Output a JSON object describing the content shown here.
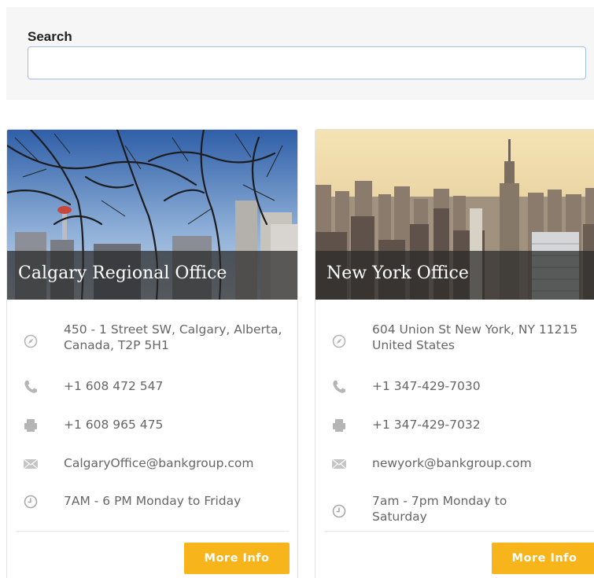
{
  "search": {
    "label": "Search",
    "value": "",
    "placeholder": ""
  },
  "offices": [
    {
      "title": "Calgary Regional Office",
      "address": "450 - 1 Street SW, Calgary, Alberta, Canada, T2P 5H1",
      "phone": "+1 608 472 547",
      "fax": "+1 608 965 475",
      "email": "CalgaryOffice@bankgroup.com",
      "hours": "7AM - 6 PM Monday to Friday",
      "button_label": "More Info"
    },
    {
      "title": "New York Office",
      "address": "604 Union St New York, NY 11215 United States",
      "phone": "+1 347-429-7030",
      "fax": "+1 347-429-7032",
      "email": "newyork@bankgroup.com",
      "hours": "7am - 7pm Monday to Saturday",
      "button_label": "More Info"
    }
  ],
  "icons": {
    "address": "compass-icon",
    "phone": "phone-icon",
    "fax": "fax-icon",
    "email": "envelope-icon",
    "hours": "clock-icon"
  },
  "colors": {
    "accent": "#f7b41b",
    "icon": "#b5b5b5",
    "input_border": "#9ec0e6"
  }
}
